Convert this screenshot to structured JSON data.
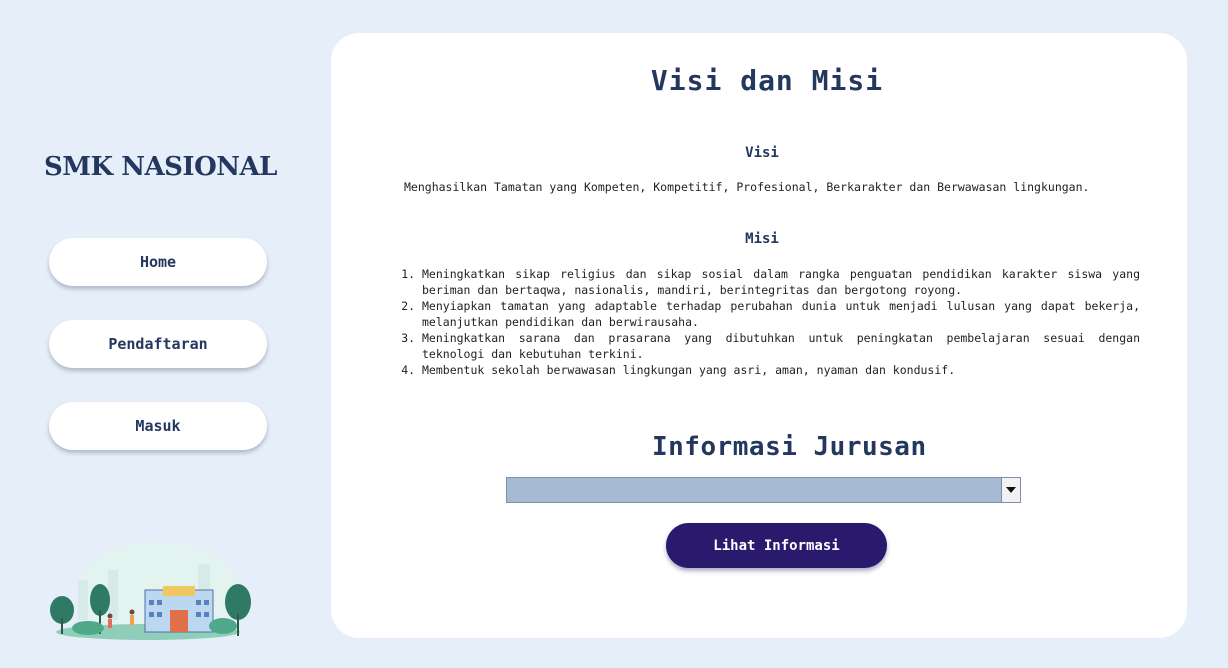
{
  "sidebar": {
    "brand": "SMK NASIONAL",
    "nav": [
      {
        "label": "Home"
      },
      {
        "label": "Pendaftaran"
      },
      {
        "label": "Masuk"
      }
    ]
  },
  "main": {
    "title": "Visi dan Misi",
    "visi_heading": "Visi",
    "visi_text": "Menghasilkan Tamatan yang Kompeten, Kompetitif, Profesional, Berkarakter dan Berwawasan lingkungan.",
    "misi_heading": "Misi",
    "misi_items": [
      "Meningkatkan sikap religius dan sikap sosial dalam rangka penguatan pendidikan karakter siswa yang beriman dan bertaqwa, nasionalis, mandiri, berintegritas dan bergotong royong.",
      "Menyiapkan tamatan yang adaptable terhadap perubahan dunia untuk menjadi lulusan yang dapat bekerja, melanjutkan pendidikan dan berwirausaha.",
      "Meningkatkan sarana dan prasarana yang dibutuhkan untuk peningkatan pembelajaran sesuai dengan teknologi dan kebutuhan terkini.",
      "Membentuk sekolah berwawasan lingkungan yang asri, aman, nyaman dan kondusif."
    ],
    "jurusan_heading": "Informasi Jurusan",
    "jurusan_select_value": "",
    "lihat_button": "Lihat Informasi"
  },
  "colors": {
    "background": "#e6eef9",
    "primary_text": "#24375e",
    "button_primary": "#2a1a6e",
    "select_fill": "#a7bad4"
  },
  "icons": {
    "illustration": "school-building-illustration",
    "select_arrow": "chevron-down-icon"
  }
}
